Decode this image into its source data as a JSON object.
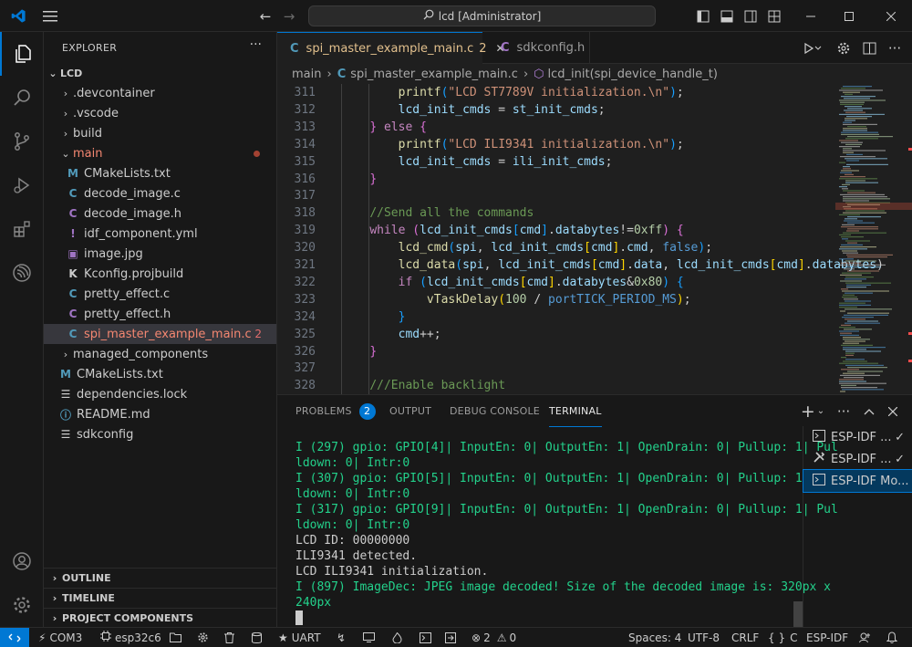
{
  "window": {
    "title": "lcd [Administrator]"
  },
  "sidebar": {
    "title": "EXPLORER",
    "root": "LCD",
    "items": [
      {
        "label": ".devcontainer",
        "type": "folder",
        "indent": 1,
        "expanded": false
      },
      {
        "label": ".vscode",
        "type": "folder",
        "indent": 1,
        "expanded": false
      },
      {
        "label": "build",
        "type": "folder",
        "indent": 1,
        "expanded": false
      },
      {
        "label": "main",
        "type": "folder",
        "indent": 1,
        "expanded": true
      },
      {
        "label": "CMakeLists.txt",
        "type": "cmake",
        "indent": 2
      },
      {
        "label": "decode_image.c",
        "type": "c",
        "indent": 2
      },
      {
        "label": "decode_image.h",
        "type": "h",
        "indent": 2
      },
      {
        "label": "idf_component.yml",
        "type": "yml",
        "indent": 2
      },
      {
        "label": "image.jpg",
        "type": "image",
        "indent": 2
      },
      {
        "label": "Kconfig.projbuild",
        "type": "kconfig",
        "indent": 2
      },
      {
        "label": "pretty_effect.c",
        "type": "c",
        "indent": 2
      },
      {
        "label": "pretty_effect.h",
        "type": "h",
        "indent": 2
      },
      {
        "label": "spi_master_example_main.c",
        "type": "c",
        "indent": 2,
        "badge": "2"
      },
      {
        "label": "managed_components",
        "type": "folder",
        "indent": 1,
        "expanded": false
      },
      {
        "label": "CMakeLists.txt",
        "type": "cmake",
        "indent": 1
      },
      {
        "label": "dependencies.lock",
        "type": "lock",
        "indent": 1
      },
      {
        "label": "README.md",
        "type": "info",
        "indent": 1
      },
      {
        "label": "sdkconfig",
        "type": "lock",
        "indent": 1
      }
    ],
    "sections": [
      "OUTLINE",
      "TIMELINE",
      "PROJECT COMPONENTS"
    ]
  },
  "tabs": [
    {
      "label": "spi_master_example_main.c",
      "badge": "2",
      "active": true
    },
    {
      "label": "sdkconfig.h",
      "active": false
    }
  ],
  "breadcrumb": [
    "main",
    "spi_master_example_main.c",
    "lcd_init(spi_device_handle_t)"
  ],
  "code_lines": [
    {
      "n": "311",
      "indent": 8,
      "tokens": [
        [
          "fn",
          "printf"
        ],
        [
          "br3",
          "("
        ],
        [
          "str",
          "\"LCD ST7789V initialization.\\n\""
        ],
        [
          "br3",
          ")"
        ],
        [
          "",
          "; "
        ]
      ]
    },
    {
      "n": "312",
      "indent": 8,
      "tokens": [
        [
          "var",
          "lcd_init_cmds"
        ],
        [
          "",
          " = "
        ],
        [
          "var",
          "st_init_cmds"
        ],
        [
          "",
          ";"
        ]
      ]
    },
    {
      "n": "313",
      "indent": 4,
      "tokens": [
        [
          "br2",
          "}"
        ],
        [
          "",
          " "
        ],
        [
          "kw2",
          "else"
        ],
        [
          "",
          " "
        ],
        [
          "br2",
          "{"
        ]
      ]
    },
    {
      "n": "314",
      "indent": 8,
      "tokens": [
        [
          "fn",
          "printf"
        ],
        [
          "br3",
          "("
        ],
        [
          "str",
          "\"LCD ILI9341 initialization.\\n\""
        ],
        [
          "br3",
          ")"
        ],
        [
          "",
          ";"
        ]
      ]
    },
    {
      "n": "315",
      "indent": 8,
      "tokens": [
        [
          "var",
          "lcd_init_cmds"
        ],
        [
          "",
          " = "
        ],
        [
          "var",
          "ili_init_cmds"
        ],
        [
          "",
          ";"
        ]
      ]
    },
    {
      "n": "316",
      "indent": 4,
      "tokens": [
        [
          "br2",
          "}"
        ]
      ]
    },
    {
      "n": "317",
      "indent": 0,
      "tokens": []
    },
    {
      "n": "318",
      "indent": 4,
      "tokens": [
        [
          "cm",
          "//Send all the commands"
        ]
      ]
    },
    {
      "n": "319",
      "indent": 4,
      "tokens": [
        [
          "kw2",
          "while"
        ],
        [
          "",
          " "
        ],
        [
          "br2",
          "("
        ],
        [
          "var",
          "lcd_init_cmds"
        ],
        [
          "br3",
          "["
        ],
        [
          "var",
          "cmd"
        ],
        [
          "br3",
          "]"
        ],
        [
          "",
          "."
        ],
        [
          "var",
          "databytes"
        ],
        [
          "",
          "!="
        ],
        [
          "num",
          "0xff"
        ],
        [
          "br2",
          ")"
        ],
        [
          "",
          " "
        ],
        [
          "br2",
          "{"
        ]
      ]
    },
    {
      "n": "320",
      "indent": 8,
      "tokens": [
        [
          "fn",
          "lcd_cmd"
        ],
        [
          "br3",
          "("
        ],
        [
          "var",
          "spi"
        ],
        [
          "",
          ", "
        ],
        [
          "var",
          "lcd_init_cmds"
        ],
        [
          "br",
          "["
        ],
        [
          "var",
          "cmd"
        ],
        [
          "br",
          "]"
        ],
        [
          "",
          "."
        ],
        [
          "var",
          "cmd"
        ],
        [
          "",
          ", "
        ],
        [
          "kw",
          "false"
        ],
        [
          "br3",
          ")"
        ],
        [
          "",
          ";"
        ]
      ]
    },
    {
      "n": "321",
      "indent": 8,
      "tokens": [
        [
          "fn",
          "lcd_data"
        ],
        [
          "br3",
          "("
        ],
        [
          "var",
          "spi"
        ],
        [
          "",
          ", "
        ],
        [
          "var",
          "lcd_init_cmds"
        ],
        [
          "br",
          "["
        ],
        [
          "var",
          "cmd"
        ],
        [
          "br",
          "]"
        ],
        [
          "",
          "."
        ],
        [
          "var",
          "data"
        ],
        [
          "",
          ", "
        ],
        [
          "var",
          "lcd_init_cmds"
        ],
        [
          "br",
          "["
        ],
        [
          "var",
          "cmd"
        ],
        [
          "br",
          "]"
        ],
        [
          "",
          "."
        ],
        [
          "var",
          "databytes"
        ],
        [
          "",
          ")"
        ]
      ]
    },
    {
      "n": "322",
      "indent": 8,
      "tokens": [
        [
          "kw2",
          "if"
        ],
        [
          "",
          " "
        ],
        [
          "br3",
          "("
        ],
        [
          "var",
          "lcd_init_cmds"
        ],
        [
          "br",
          "["
        ],
        [
          "var",
          "cmd"
        ],
        [
          "br",
          "]"
        ],
        [
          "",
          "."
        ],
        [
          "var",
          "databytes"
        ],
        [
          "",
          "&"
        ],
        [
          "num",
          "0x80"
        ],
        [
          "br3",
          ")"
        ],
        [
          "",
          " "
        ],
        [
          "br3",
          "{"
        ]
      ]
    },
    {
      "n": "323",
      "indent": 12,
      "tokens": [
        [
          "fn",
          "vTaskDelay"
        ],
        [
          "br",
          "("
        ],
        [
          "num",
          "100"
        ],
        [
          "",
          " / "
        ],
        [
          "mac",
          "portTICK_PERIOD_MS"
        ],
        [
          "br",
          ")"
        ],
        [
          "",
          ";"
        ]
      ]
    },
    {
      "n": "324",
      "indent": 8,
      "tokens": [
        [
          "br3",
          "}"
        ]
      ]
    },
    {
      "n": "325",
      "indent": 8,
      "tokens": [
        [
          "var",
          "cmd"
        ],
        [
          "",
          "++;"
        ]
      ]
    },
    {
      "n": "326",
      "indent": 4,
      "tokens": [
        [
          "br2",
          "}"
        ]
      ]
    },
    {
      "n": "327",
      "indent": 0,
      "tokens": []
    },
    {
      "n": "328",
      "indent": 4,
      "tokens": [
        [
          "cm",
          "///Enable backlight"
        ]
      ]
    }
  ],
  "panel": {
    "tabs": [
      {
        "label": "PROBLEMS",
        "badge": "2"
      },
      {
        "label": "OUTPUT"
      },
      {
        "label": "DEBUG CONSOLE"
      },
      {
        "label": "TERMINAL",
        "active": true
      }
    ],
    "terminal_lines": [
      {
        "text": "I (297) gpio: GPIO[4]| InputEn: 0| OutputEn: 1| OpenDrain: 0| Pullup: 1| Pul",
        "color": "#23d18b"
      },
      {
        "text": "ldown: 0| Intr:0",
        "color": "#23d18b"
      },
      {
        "text": "I (307) gpio: GPIO[5]| InputEn: 0| OutputEn: 1| OpenDrain: 0| Pullup: 1| Pul",
        "color": "#23d18b"
      },
      {
        "text": "ldown: 0| Intr:0",
        "color": "#23d18b"
      },
      {
        "text": "I (317) gpio: GPIO[9]| InputEn: 0| OutputEn: 1| OpenDrain: 0| Pullup: 1| Pul",
        "color": "#23d18b"
      },
      {
        "text": "ldown: 0| Intr:0",
        "color": "#23d18b"
      },
      {
        "text": "LCD ID: 00000000",
        "color": "#cccccc"
      },
      {
        "text": "ILI9341 detected.",
        "color": "#cccccc"
      },
      {
        "text": "LCD ILI9341 initialization.",
        "color": "#cccccc"
      },
      {
        "text": "I (897) ImageDec: JPEG image decoded! Size of the decoded image is: 320px x",
        "color": "#23d18b"
      },
      {
        "text": "240px",
        "color": "#23d18b"
      }
    ],
    "terminal_list": [
      {
        "label": "ESP-IDF ...",
        "icon": "terminal-icon",
        "check": true
      },
      {
        "label": "ESP-IDF ...",
        "icon": "tools-icon",
        "check": true
      },
      {
        "label": "ESP-IDF Mo...",
        "icon": "terminal-icon",
        "check": false,
        "active": true
      }
    ]
  },
  "statusbar": {
    "port": "COM3",
    "target": "esp32c6",
    "uart": "UART",
    "errors": "2",
    "warnings": "0",
    "spaces": "Spaces: 4",
    "encoding": "UTF-8",
    "eol": "CRLF",
    "language": "C",
    "framework": "ESP-IDF"
  },
  "colors": {
    "accent": "#0078d4",
    "terminal_green": "#23d18b",
    "error": "#f14c4c"
  }
}
